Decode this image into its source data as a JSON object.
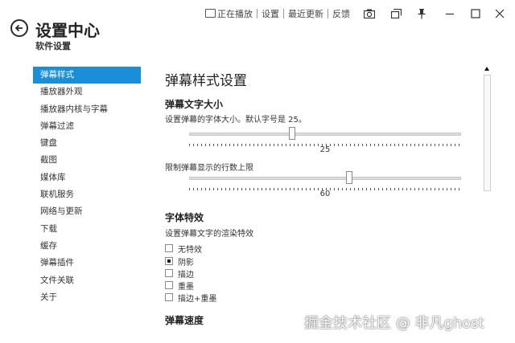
{
  "header": {
    "title": "设置中心",
    "subtitle": "软件设置",
    "nav": {
      "now_playing": "正在播放",
      "settings": "设置",
      "recent_updates": "最近更新",
      "feedback": "反馈"
    }
  },
  "sidebar": {
    "items": [
      {
        "label": "弹幕样式",
        "active": true
      },
      {
        "label": "播放器外观"
      },
      {
        "label": "播放器内核与字幕"
      },
      {
        "label": "弹幕过滤"
      },
      {
        "label": "键盘"
      },
      {
        "label": "截图"
      },
      {
        "label": "媒体库"
      },
      {
        "label": "联机服务"
      },
      {
        "label": "网络与更新"
      },
      {
        "label": "下载"
      },
      {
        "label": "缓存"
      },
      {
        "label": "弹幕插件"
      },
      {
        "label": "文件关联"
      },
      {
        "label": "关于"
      }
    ]
  },
  "main": {
    "title": "弹幕样式设置",
    "font_size": {
      "heading": "弹幕文字大小",
      "desc": "设置弹幕的字体大小。默认字号是 25。",
      "value": "25",
      "position": 0.38
    },
    "line_limit": {
      "desc": "限制弹幕显示的行数上限",
      "value": "60",
      "position": 0.59
    },
    "font_effects": {
      "heading": "字体特效",
      "desc": "设置弹幕文字的渲染特效",
      "options": [
        {
          "label": "无特效",
          "checked": false
        },
        {
          "label": "阴影",
          "checked": true
        },
        {
          "label": "描边",
          "checked": false
        },
        {
          "label": "重墨",
          "checked": false
        },
        {
          "label": "描边+重墨",
          "checked": false
        }
      ]
    },
    "speed": {
      "heading": "弹幕速度"
    }
  },
  "watermark": "掘金技术社区 @ 非凡ghost",
  "colors": {
    "accent": "#1a8fd9"
  }
}
